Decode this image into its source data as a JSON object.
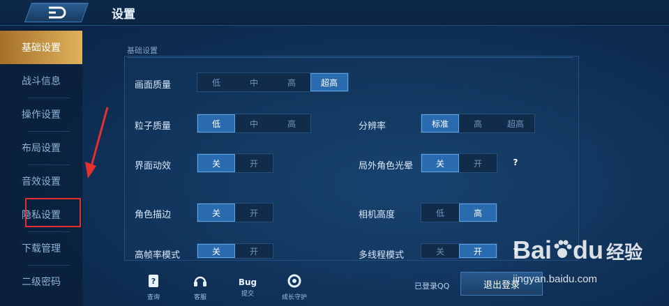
{
  "header": {
    "title": "设置"
  },
  "sidebar": {
    "items": [
      {
        "label": "基础设置"
      },
      {
        "label": "战斗信息"
      },
      {
        "label": "操作设置"
      },
      {
        "label": "布局设置"
      },
      {
        "label": "音效设置"
      },
      {
        "label": "隐私设置"
      },
      {
        "label": "下载管理"
      },
      {
        "label": "二级密码"
      }
    ],
    "active_index": 0,
    "highlighted_index": 5
  },
  "section": {
    "label": "基础设置"
  },
  "settings": {
    "quality": {
      "label": "画面质量",
      "options": [
        "低",
        "中",
        "高",
        "超高"
      ],
      "selected": "超高"
    },
    "particle": {
      "label": "粒子质量",
      "options": [
        "低",
        "中",
        "高"
      ],
      "selected": "低"
    },
    "resolution": {
      "label": "分辨率",
      "options": [
        "标准",
        "高",
        "超高"
      ],
      "selected": "标准"
    },
    "ui_anim": {
      "label": "界面动效",
      "options": [
        "关",
        "开"
      ],
      "selected": "关"
    },
    "halo": {
      "label": "局外角色光晕",
      "options": [
        "关",
        "开"
      ],
      "selected": "关",
      "help": "?"
    },
    "outline": {
      "label": "角色描边",
      "options": [
        "关",
        "开"
      ],
      "selected": "关"
    },
    "camera": {
      "label": "相机高度",
      "options": [
        "低",
        "高"
      ],
      "selected": "高"
    },
    "hfr": {
      "label": "高帧率模式",
      "options": [
        "关",
        "开"
      ],
      "selected": "关"
    },
    "multithread": {
      "label": "多线程模式",
      "options": [
        "关",
        "开"
      ],
      "selected": "开",
      "help": "?"
    }
  },
  "bottom": {
    "icons": [
      {
        "label": "查询"
      },
      {
        "label": "客服"
      },
      {
        "label": "提交",
        "top": "Bug"
      },
      {
        "label": "成长守护"
      }
    ],
    "qq_status": "已登录QQ",
    "logout_label": "退出登录"
  },
  "watermark": {
    "brand_left": "Bai",
    "brand_right": "du",
    "cn": "经验",
    "url": "jingyan.baidu.com"
  },
  "colors": {
    "accent": "#2a6bb0",
    "active_tab": "#e0b25c",
    "annotation": "#e63030"
  }
}
